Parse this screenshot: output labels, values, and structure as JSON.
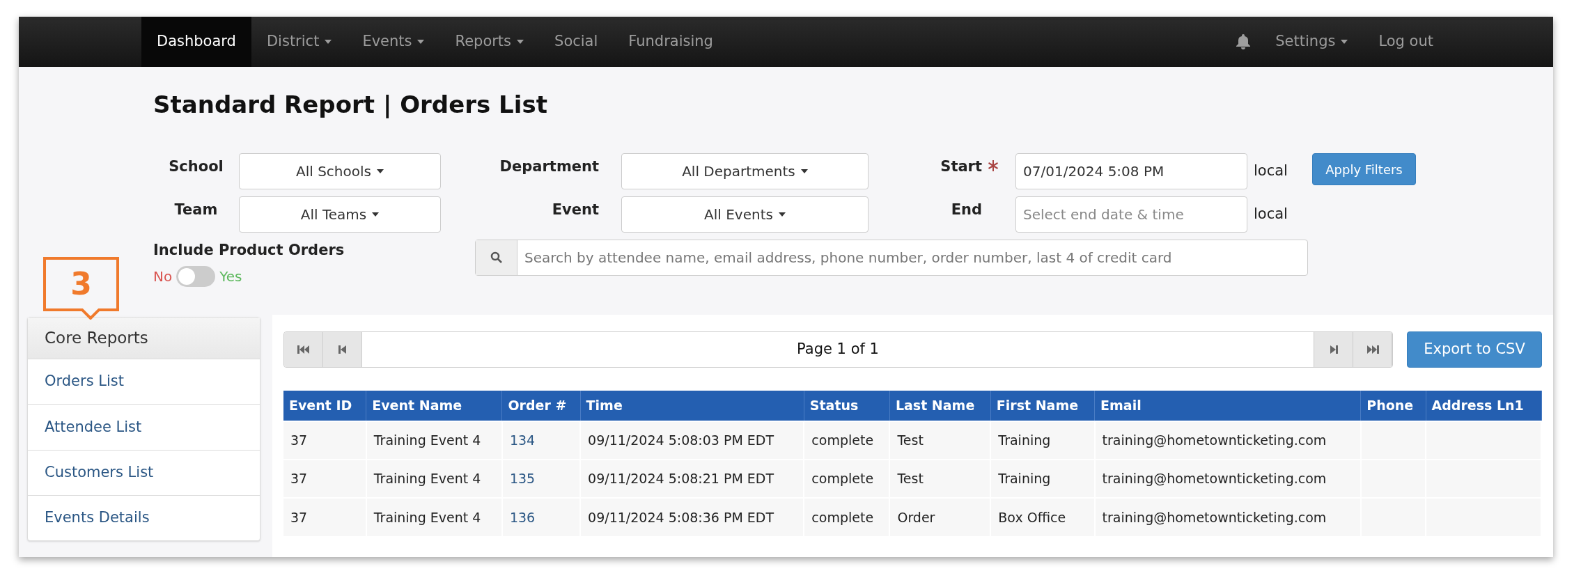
{
  "nav": {
    "items": [
      {
        "label": "Dashboard",
        "selected": true,
        "dropdown": false
      },
      {
        "label": "District",
        "selected": false,
        "dropdown": true
      },
      {
        "label": "Events",
        "selected": false,
        "dropdown": true
      },
      {
        "label": "Reports",
        "selected": false,
        "dropdown": true
      },
      {
        "label": "Social",
        "selected": false,
        "dropdown": false
      },
      {
        "label": "Fundraising",
        "selected": false,
        "dropdown": false
      }
    ],
    "right": [
      {
        "kind": "bell"
      },
      {
        "kind": "link",
        "label": "Settings",
        "dropdown": true
      },
      {
        "kind": "link",
        "label": "Log out",
        "dropdown": false
      }
    ]
  },
  "title": "Standard Report | Orders List",
  "filters": {
    "rows": [
      {
        "label1": "School",
        "select1": "All Schools",
        "label2": "Department",
        "select2": "All Departments",
        "label3": "Start",
        "required": true,
        "date": {
          "value": "07/01/2024 5:08 PM"
        },
        "suffix": "local",
        "button": "Apply Filters"
      },
      {
        "label1": "Team",
        "select1": "All Teams",
        "label2": "Event",
        "select2": "All Events",
        "label3": "End",
        "required": false,
        "date": {
          "placeholder": "Select end date & time"
        },
        "suffix": "local"
      }
    ],
    "include": {
      "label": "Include Product Orders",
      "off_label": "No",
      "on_label": "Yes",
      "on": false
    },
    "search": {
      "placeholder": "Search by attendee name, email address, phone number, order number, last 4 of credit card"
    }
  },
  "callout": "3",
  "sidebar": {
    "title": "Core Reports",
    "items": [
      "Orders List",
      "Attendee List",
      "Customers List",
      "Events Details"
    ]
  },
  "pager": {
    "text": "Page 1 of 1"
  },
  "export_button": "Export to CSV",
  "table": {
    "columns": [
      "Event ID",
      "Event Name",
      "Order #",
      "Time",
      "Status",
      "Last Name",
      "First Name",
      "Email",
      "Phone",
      "Address Ln1"
    ],
    "rows": [
      [
        "37",
        "Training Event 4",
        "134",
        "09/11/2024 5:08:03 PM EDT",
        "complete",
        "Test",
        "Training",
        "training@hometownticketing.com",
        "",
        ""
      ],
      [
        "37",
        "Training Event 4",
        "135",
        "09/11/2024 5:08:21 PM EDT",
        "complete",
        "Test",
        "Training",
        "training@hometownticketing.com",
        "",
        ""
      ],
      [
        "37",
        "Training Event 4",
        "136",
        "09/11/2024 5:08:36 PM EDT",
        "complete",
        "Order",
        "Box Office",
        "training@hometownticketing.com",
        "",
        ""
      ]
    ]
  }
}
